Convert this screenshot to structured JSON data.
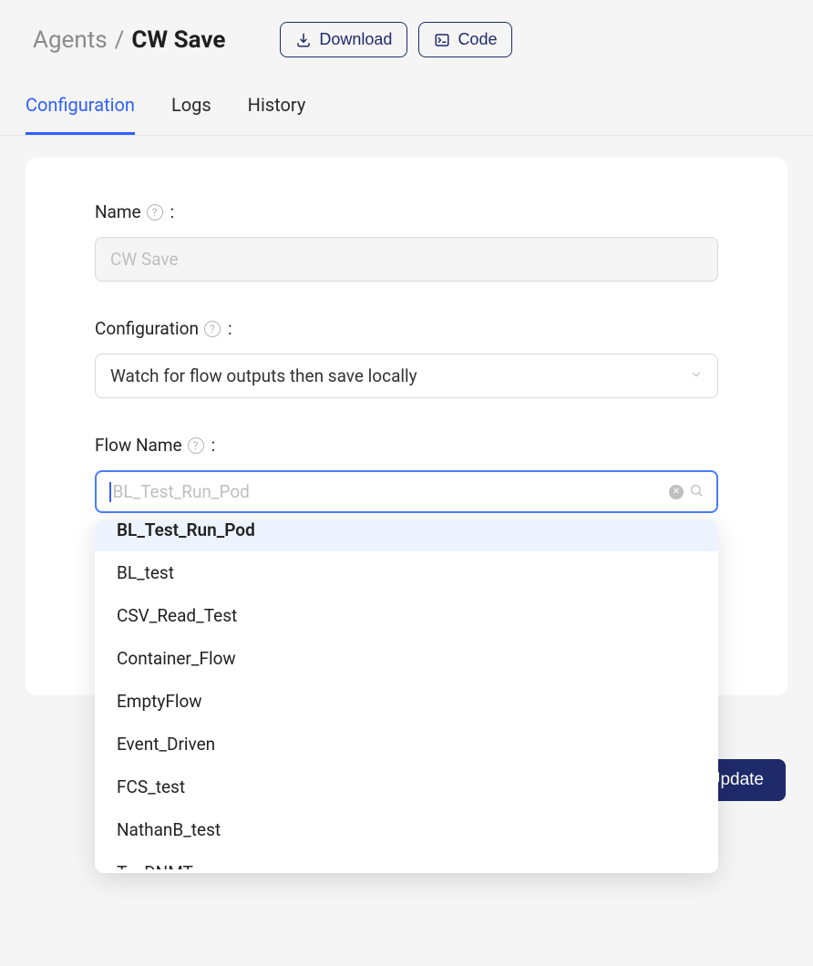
{
  "breadcrumb": {
    "parent": "Agents",
    "current": "CW Save"
  },
  "header_buttons": {
    "download": "Download",
    "code": "Code"
  },
  "tabs": {
    "configuration": "Configuration",
    "logs": "Logs",
    "history": "History"
  },
  "form": {
    "name_label": "Name",
    "name_value": "CW Save",
    "configuration_label": "Configuration",
    "configuration_value": "Watch for flow outputs then save locally",
    "flow_name_label": "Flow Name",
    "flow_name_placeholder": "BL_Test_Run_Pod",
    "colon": ":"
  },
  "dropdown": {
    "options": [
      "BL_Test_Run_Pod",
      "BL_test",
      "CSV_Read_Test",
      "Container_Flow",
      "EmptyFlow",
      "Event_Driven",
      "FCS_test",
      "NathanB_test",
      "Test_DNMT..."
    ]
  },
  "update_button": "Update"
}
